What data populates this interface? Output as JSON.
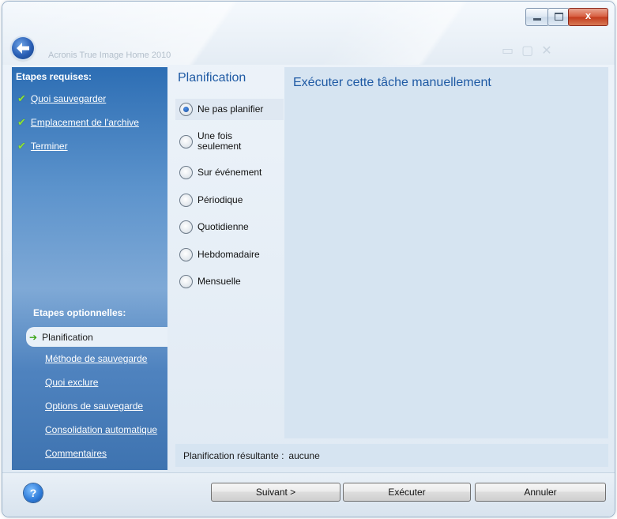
{
  "window": {
    "app_title": "Acronis True Image Home 2010",
    "controls": {
      "close_label": "x"
    }
  },
  "sidebar": {
    "required_heading": "Etapes requises:",
    "required_steps": [
      {
        "label": "Quoi sauvegarder"
      },
      {
        "label": "Emplacement de l'archive"
      },
      {
        "label": "Terminer"
      }
    ],
    "optional_heading": "Etapes optionnelles:",
    "active_step": "Planification",
    "optional_steps": [
      {
        "label": "Méthode de sauvegarde"
      },
      {
        "label": "Quoi exclure"
      },
      {
        "label": "Options de sauvegarde"
      },
      {
        "label": "Consolidation automatique"
      },
      {
        "label": "Commentaires"
      }
    ]
  },
  "schedule": {
    "title": "Planification",
    "options": [
      {
        "label": "Ne pas planifier",
        "selected": true
      },
      {
        "label": "Une fois seulement",
        "selected": false
      },
      {
        "label": "Sur événement",
        "selected": false
      },
      {
        "label": "Périodique",
        "selected": false
      },
      {
        "label": "Quotidienne",
        "selected": false
      },
      {
        "label": "Hebdomadaire",
        "selected": false
      },
      {
        "label": "Mensuelle",
        "selected": false
      }
    ]
  },
  "detail": {
    "title": "Exécuter cette tâche manuellement"
  },
  "summary": {
    "label": "Planification résultante :",
    "value": "aucune"
  },
  "buttons": {
    "help": "?",
    "next": "Suivant >",
    "run": "Exécuter",
    "cancel": "Annuler"
  }
}
